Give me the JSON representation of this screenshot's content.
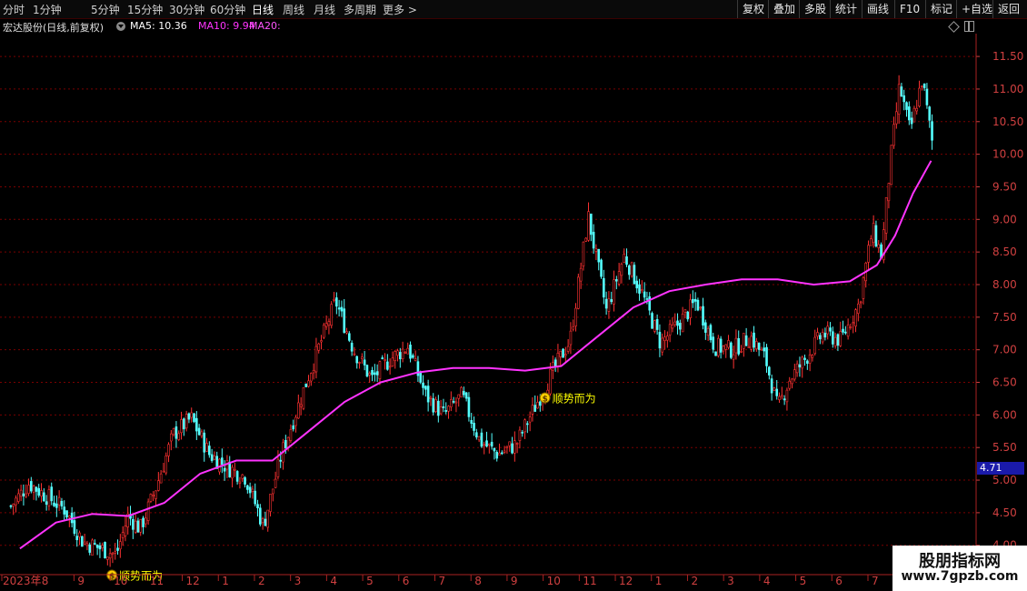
{
  "toolbar": {
    "periods": [
      "分时",
      "1分钟",
      "5分钟",
      "15分钟",
      "30分钟",
      "60分钟",
      "日线",
      "周线",
      "月线",
      "多周期",
      "更多"
    ],
    "active_period": "日线",
    "right_buttons": [
      "复权",
      "叠加",
      "多股",
      "统计",
      "画线",
      "F10",
      "标记",
      "+自选",
      "返回"
    ]
  },
  "info": {
    "stock_title": "宏达股份(日线,前复权)",
    "ma5": "MA5: 10.36",
    "ma10": "MA10: 9.94",
    "ma20": "MA20:"
  },
  "price_tag": "4.71",
  "signals": [
    {
      "label": "顺势而为",
      "date": "2023-10"
    },
    {
      "label": "顺势而为",
      "date": "2024-10"
    }
  ],
  "watermark": {
    "title": "股朋指标网",
    "url": "www.7gpzb.com"
  },
  "chart_data": {
    "type": "candlestick",
    "y_ticks": [
      "11.50",
      "11.00",
      "10.50",
      "10.00",
      "9.50",
      "9.00",
      "8.50",
      "8.00",
      "7.50",
      "7.00",
      "6.50",
      "6.00",
      "5.50",
      "5.00",
      "4.50",
      "4.00"
    ],
    "x_labels": [
      "2023年",
      "8",
      "9",
      "10",
      "11",
      "12",
      "1",
      "2",
      "3",
      "4",
      "5",
      "6",
      "7",
      "8",
      "9",
      "10",
      "11",
      "12",
      "1",
      "2",
      "3",
      "4",
      "5",
      "6",
      "7"
    ],
    "ylim": [
      3.55,
      11.85
    ],
    "grid": true,
    "close_path": [
      [
        "2023-07",
        4.6
      ],
      [
        "2023-07",
        4.95
      ],
      [
        "2023-08",
        4.75
      ],
      [
        "2023-08",
        4.55
      ],
      [
        "2023-09",
        4.05
      ],
      [
        "2023-09",
        3.95
      ],
      [
        "2023-10",
        3.85
      ],
      [
        "2023-10",
        4.45
      ],
      [
        "2023-10",
        4.25
      ],
      [
        "2023-11",
        4.85
      ],
      [
        "2023-11",
        5.7
      ],
      [
        "2023-12",
        5.95
      ],
      [
        "2023-12",
        5.4
      ],
      [
        "2024-01",
        5.2
      ],
      [
        "2024-01",
        5.05
      ],
      [
        "2024-02",
        4.3
      ],
      [
        "2024-02",
        5.4
      ],
      [
        "2024-03",
        6.6
      ],
      [
        "2024-04",
        7.75
      ],
      [
        "2024-04",
        7.0
      ],
      [
        "2024-05",
        6.55
      ],
      [
        "2024-05",
        6.85
      ],
      [
        "2024-06",
        7.05
      ],
      [
        "2024-06",
        6.3
      ],
      [
        "2024-07",
        6.0
      ],
      [
        "2024-07",
        6.3
      ],
      [
        "2024-08",
        5.6
      ],
      [
        "2024-08",
        5.4
      ],
      [
        "2024-09",
        5.55
      ],
      [
        "2024-09",
        6.1
      ],
      [
        "2024-10",
        6.65
      ],
      [
        "2024-10",
        7.15
      ],
      [
        "2024-11",
        9.05
      ],
      [
        "2024-11",
        7.6
      ],
      [
        "2024-12",
        8.45
      ],
      [
        "2024-12",
        7.85
      ],
      [
        "2025-01",
        7.1
      ],
      [
        "2025-01",
        7.4
      ],
      [
        "2025-02",
        7.75
      ],
      [
        "2025-02",
        7.05
      ],
      [
        "2025-03",
        7.0
      ],
      [
        "2025-03",
        7.2
      ],
      [
        "2025-04",
        6.85
      ],
      [
        "2025-04",
        6.1
      ],
      [
        "2025-04",
        6.55
      ],
      [
        "2025-05",
        6.85
      ],
      [
        "2025-05",
        7.25
      ],
      [
        "2025-06",
        7.15
      ],
      [
        "2025-06",
        7.7
      ],
      [
        "2025-07",
        8.85
      ],
      [
        "2025-07",
        8.45
      ],
      [
        "2025-07",
        9.9
      ],
      [
        "2025-07",
        11.05
      ],
      [
        "2025-08",
        10.35
      ],
      [
        "2025-08",
        11.15
      ],
      [
        "2025-08",
        10.0
      ]
    ],
    "ma_path": [
      [
        "2023-07",
        3.95
      ],
      [
        "2023-08",
        4.35
      ],
      [
        "2023-09",
        4.48
      ],
      [
        "2023-10",
        4.45
      ],
      [
        "2023-11",
        4.65
      ],
      [
        "2023-12",
        5.1
      ],
      [
        "2024-01",
        5.3
      ],
      [
        "2024-02",
        5.3
      ],
      [
        "2024-03",
        5.75
      ],
      [
        "2024-04",
        6.2
      ],
      [
        "2024-05",
        6.5
      ],
      [
        "2024-06",
        6.65
      ],
      [
        "2024-07",
        6.72
      ],
      [
        "2024-08",
        6.72
      ],
      [
        "2024-09",
        6.68
      ],
      [
        "2024-10",
        6.75
      ],
      [
        "2024-11",
        7.2
      ],
      [
        "2024-12",
        7.65
      ],
      [
        "2025-01",
        7.9
      ],
      [
        "2025-02",
        8.0
      ],
      [
        "2025-03",
        8.08
      ],
      [
        "2025-04",
        8.08
      ],
      [
        "2025-05",
        8.0
      ],
      [
        "2025-06",
        8.05
      ],
      [
        "2025-07",
        8.3
      ],
      [
        "2025-07",
        8.75
      ],
      [
        "2025-08",
        9.4
      ],
      [
        "2025-08",
        9.9
      ]
    ]
  },
  "colors": {
    "up": "#ff3232",
    "down": "#54ffff",
    "ma": "#ff33ff",
    "grid": "#7a0000",
    "axis_text": "#d04040",
    "signal": "#ffff00"
  }
}
